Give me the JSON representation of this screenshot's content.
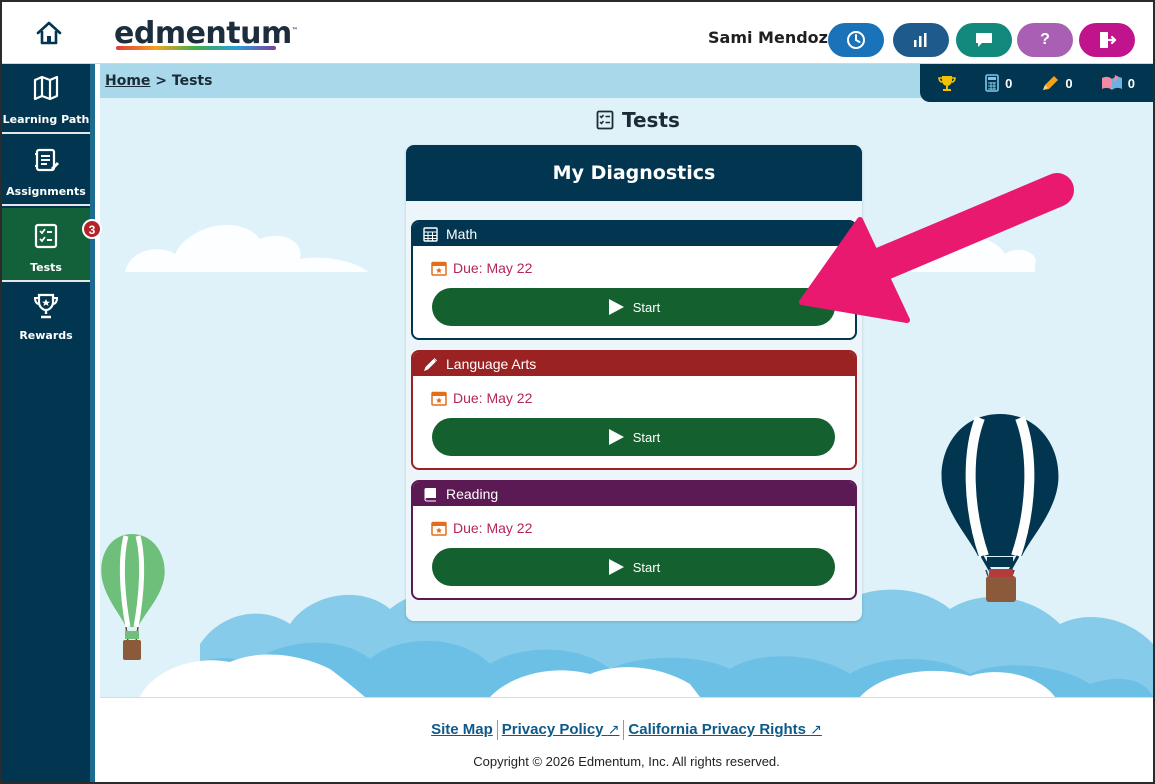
{
  "header": {
    "logo_text": "edmentum",
    "user_name": "Sami Mendoza",
    "buttons": [
      {
        "name": "clock-icon",
        "color": "#1a73b8"
      },
      {
        "name": "chart-icon",
        "color": "#1e5a8c"
      },
      {
        "name": "message-icon",
        "color": "#11897c"
      },
      {
        "name": "help-icon",
        "label": "?",
        "color": "#a85fb4"
      },
      {
        "name": "logout-icon",
        "color": "#c0148d"
      }
    ]
  },
  "sidebar": {
    "items": [
      {
        "label": "Learning Path",
        "icon": "map-icon"
      },
      {
        "label": "Assignments",
        "icon": "assignments-icon"
      },
      {
        "label": "Tests",
        "icon": "tests-icon",
        "active": true,
        "badge": "3"
      },
      {
        "label": "Rewards",
        "icon": "trophy-icon"
      }
    ]
  },
  "breadcrumb": {
    "home": "Home",
    "separator": ">",
    "current": "Tests"
  },
  "stats": {
    "calculator": "0",
    "pencil": "0",
    "book": "0"
  },
  "page": {
    "title": "Tests"
  },
  "panel": {
    "title": "My Diagnostics",
    "cards": [
      {
        "subject": "Math",
        "due": "Due: May 22",
        "start": "Start",
        "color": "#02354f"
      },
      {
        "subject": "Language Arts",
        "due": "Due: May 22",
        "start": "Start",
        "color": "#9b2222"
      },
      {
        "subject": "Reading",
        "due": "Due: May 22",
        "start": "Start",
        "color": "#5c1a55"
      }
    ]
  },
  "footer": {
    "site_map": "Site Map",
    "privacy_policy": "Privacy Policy",
    "california_privacy": "California Privacy Rights",
    "copyright": "Copyright © 2026 Edmentum, Inc. All rights reserved."
  },
  "colors": {
    "sidebar": "#02354f",
    "active": "#12613a",
    "start_button": "#14612f",
    "annotation_arrow": "#e8196f"
  }
}
